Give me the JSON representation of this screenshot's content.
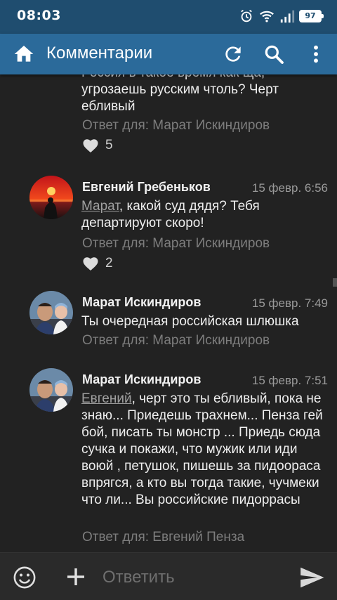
{
  "status_bar": {
    "time": "08:03",
    "battery": "97"
  },
  "toolbar": {
    "title": "Комментарии"
  },
  "comments": [
    {
      "text_lines": [
        "Россия в такое время как ща,",
        "угрозаешь русским чтоль? Черт",
        "ебливый"
      ],
      "reply_to": "Ответ для: Марат Искиндиров",
      "likes": "5"
    },
    {
      "author": "Евгений Гребеньков",
      "date": "15 февр. 6:56",
      "mention": "Марат",
      "text": ", какой суд дядя? Тебя департируют скоро!",
      "reply_to": "Ответ для: Марат Искиндиров",
      "likes": "2"
    },
    {
      "author": "Марат Искиндиров",
      "date": "15 февр. 7:49",
      "text": "Ты очередная российская шлюшка",
      "reply_to": "Ответ для: Марат Искиндиров"
    },
    {
      "author": "Марат Искиндиров",
      "date": "15 февр. 7:51",
      "mention": "Евгений",
      "text": ", черт это ты ебливый, пока не знаю... Приедешь трахнем... Пенза гей бой, писать ты монстр ... Приедь сюда сучка и покажи, что мужик или иди воюй , петушок, пишешь за пидоораса впрягся, а кто вы тогда такие, чучмеки что ли... Вы российские пидоррасы",
      "reply_to": "Ответ для: Евгений Пенза"
    }
  ],
  "input": {
    "placeholder": "Ответить"
  }
}
